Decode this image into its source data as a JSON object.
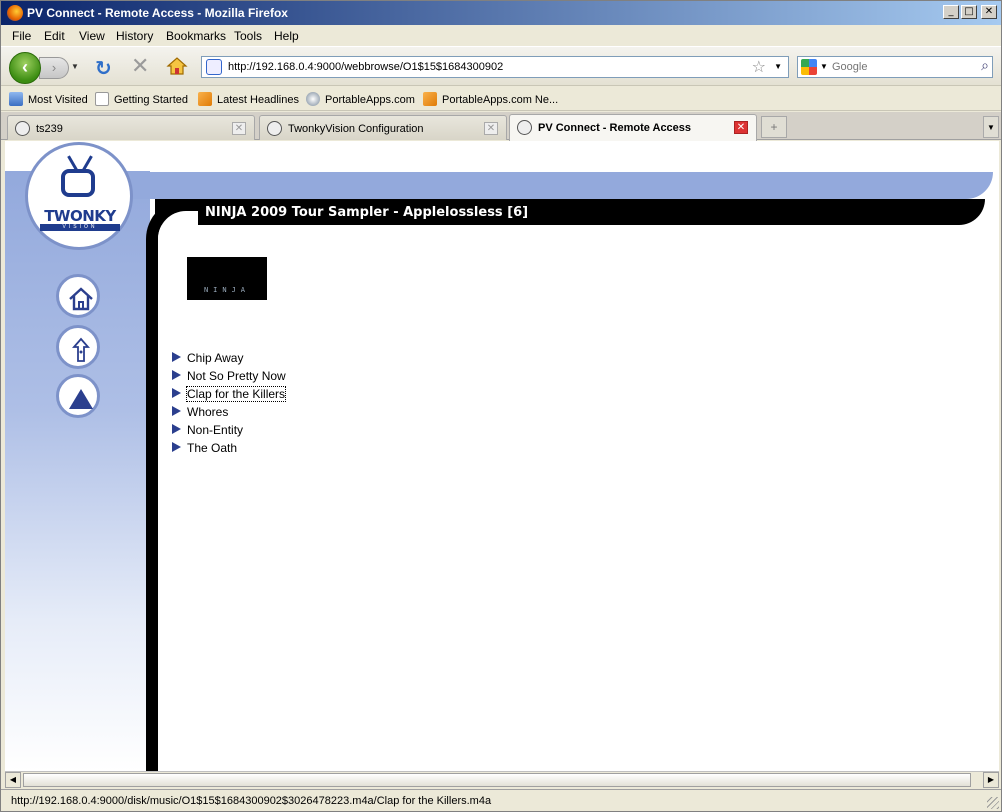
{
  "window": {
    "title": "PV Connect - Remote Access - Mozilla Firefox",
    "controls": {
      "minimize": "_",
      "maximize": "□",
      "close": "✕"
    }
  },
  "menu": [
    "File",
    "Edit",
    "View",
    "History",
    "Bookmarks",
    "Tools",
    "Help"
  ],
  "navbar": {
    "url": "http://192.168.0.4:9000/webbrowse/O1$15$1684300902",
    "search_placeholder": "Google"
  },
  "bookmarks": [
    {
      "label": "Most Visited",
      "icon": "most-visited-icon"
    },
    {
      "label": "Getting Started",
      "icon": "page-icon"
    },
    {
      "label": "Latest Headlines",
      "icon": "rss-icon"
    },
    {
      "label": "PortableApps.com",
      "icon": "portableapps-icon"
    },
    {
      "label": "PortableApps.com Ne...",
      "icon": "rss-icon"
    }
  ],
  "tabs": [
    {
      "label": "ts239",
      "active": false
    },
    {
      "label": "TwonkyVision Configuration",
      "active": false
    },
    {
      "label": "PV Connect - Remote Access",
      "active": true
    }
  ],
  "page": {
    "logo_brand": "TWONKY",
    "logo_sub": "VISION",
    "header_title": "NINJA 2009 Tour Sampler - Applelossless [6]",
    "album_art_text": "NINJA",
    "tracks": [
      "Chip Away",
      "Not So Pretty Now",
      "Clap for the Killers",
      "Whores",
      "Non-Entity",
      "The Oath"
    ],
    "focused_track_index": 2
  },
  "status": {
    "text": "http://192.168.0.4:9000/disk/music/O1$15$1684300902$3026478223.m4a/Clap for the Killers.m4a"
  },
  "colors": {
    "header_band": "#000000",
    "sidebar_blue": "#93a9dc",
    "brand_blue": "#1f3c8e"
  }
}
